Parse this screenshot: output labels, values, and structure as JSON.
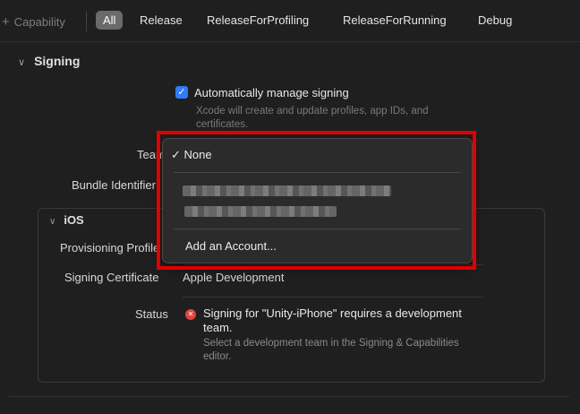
{
  "toolbar": {
    "capability_label": "Capability",
    "tabs": [
      "All",
      "Release",
      "ReleaseForProfiling",
      "ReleaseForRunning",
      "Debug"
    ]
  },
  "signing": {
    "header": "Signing",
    "auto_manage_label": "Automatically manage signing",
    "auto_manage_checked": true,
    "auto_manage_desc": "Xcode will create and update profiles, app IDs, and certificates.",
    "team_label": "Team",
    "bundle_label": "Bundle Identifier"
  },
  "ios": {
    "header": "iOS",
    "provisioning_label": "Provisioning Profile",
    "certificate_label": "Signing Certificate",
    "certificate_value": "Apple Development",
    "status_label": "Status",
    "status_message": "Signing for \"Unity-iPhone\" requires a development team.",
    "status_detail": "Select a development team in the Signing & Capabilities editor."
  },
  "team_menu": {
    "selected": "None",
    "items": [
      "None",
      "Add an Account..."
    ]
  },
  "colors": {
    "accent": "#2f7cf6",
    "error": "#e0453e",
    "highlight": "#e00000"
  }
}
